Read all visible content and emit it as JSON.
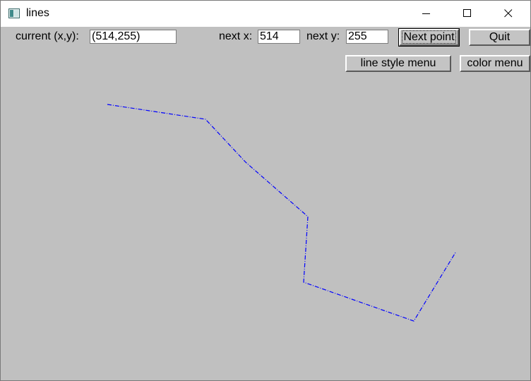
{
  "window": {
    "title": "lines",
    "controls": {
      "minimize": "minimize-icon",
      "maximize": "maximize-icon",
      "close": "close-icon"
    }
  },
  "toolbar": {
    "current_label": "current (x,y):",
    "current_value": "(514,255)",
    "next_x_label": "next x:",
    "next_x_value": "514",
    "next_y_label": "next y:",
    "next_y_value": "255",
    "next_point_label": "Next point",
    "quit_label": "Quit",
    "line_style_label": "line style menu",
    "color_label": "color menu"
  },
  "drawing": {
    "line_color": "#0000ff",
    "line_style": "dash-dot",
    "background": "#c0c0c0"
  }
}
